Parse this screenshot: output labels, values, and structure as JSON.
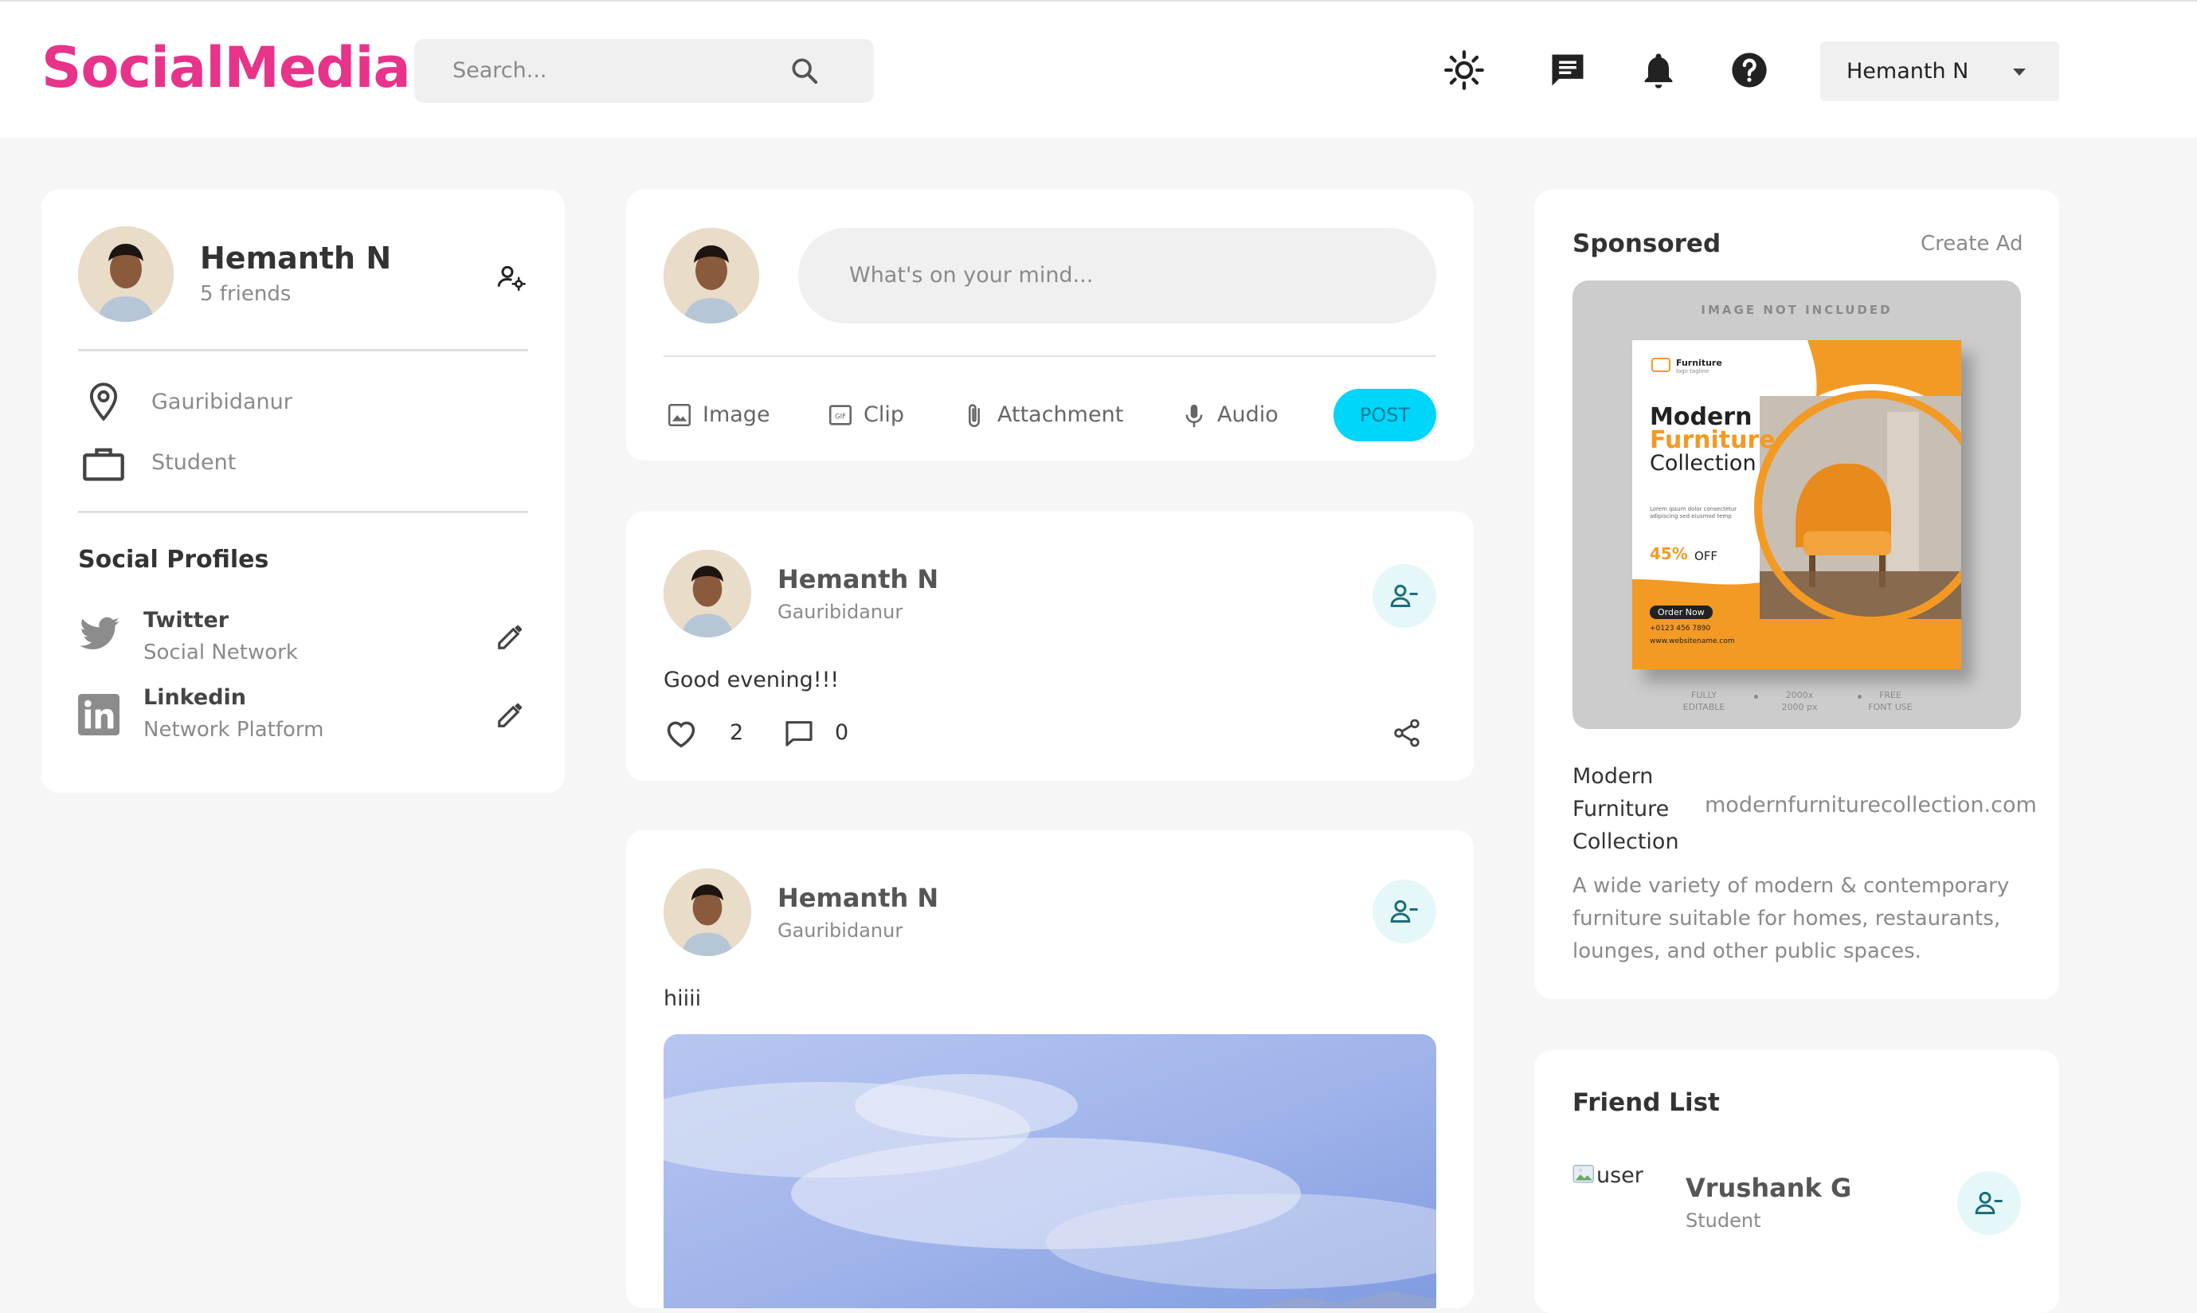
{
  "app": {
    "logo": "SocialMedia"
  },
  "search": {
    "placeholder": "Search..."
  },
  "header": {
    "user_name": "Hemanth N",
    "icons": [
      "light-mode-icon",
      "message-icon",
      "notification-bell-icon",
      "help-icon",
      "chevron-down-icon"
    ]
  },
  "profile": {
    "name": "Hemanth N",
    "friends": "5 friends",
    "location": "Gauribidanur",
    "occupation": "Student",
    "social_title": "Social Profiles",
    "socials": [
      {
        "name": "Twitter",
        "type": "Social Network",
        "icon": "twitter-icon"
      },
      {
        "name": "Linkedin",
        "type": "Network Platform",
        "icon": "linkedin-icon"
      }
    ]
  },
  "composer": {
    "placeholder": "What's on your mind...",
    "tools": [
      "Image",
      "Clip",
      "Attachment",
      "Audio"
    ],
    "post_label": "POST"
  },
  "posts": [
    {
      "author": "Hemanth N",
      "location": "Gauribidanur",
      "text": "Good evening!!!",
      "likes": "2",
      "comments": "0"
    },
    {
      "author": "Hemanth N",
      "location": "Gauribidanur",
      "text": "hiiii"
    }
  ],
  "sponsored": {
    "title": "Sponsored",
    "create_ad": "Create Ad",
    "ad_image": {
      "banner": "IMAGE NOT INCLUDED",
      "brand": "Furniture",
      "brand_tagline": "logo tagline",
      "heading_1": "Modern",
      "heading_2": "Furniture",
      "heading_3": "Collection",
      "lorem": "Lorem ipsum dolor consectetur adipiscing sed eiusmod temp",
      "discount": "45%",
      "off": "OFF",
      "order": "Order Now",
      "phone": "+0123 456 7890",
      "website": "www.websitename.com",
      "foot_1a": "FULLY",
      "foot_1b": "EDITABLE",
      "foot_2a": "2000x",
      "foot_2b": "2000 px",
      "foot_3a": "FREE",
      "foot_3b": "FONT USE"
    },
    "name_line1": "Modern",
    "name_line2": "Furniture",
    "name_line3": "Collection",
    "url": "modernfurniturecollection.com",
    "description_1": "A wide variety of modern & contemporary",
    "description_2": "furniture suitable for homes, restaurants,",
    "description_3": "lounges, and other public spaces."
  },
  "friends": {
    "title": "Friend List",
    "list": [
      {
        "alt": "user",
        "name": "Vrushank G",
        "role": "Student"
      }
    ]
  },
  "colors": {
    "brand": "#e8338a",
    "post_button": "#00d5fa",
    "friend_button_bg": "#e6f7fa",
    "friend_icon": "#1b6e7a",
    "ad_orange": "#f39a24"
  }
}
